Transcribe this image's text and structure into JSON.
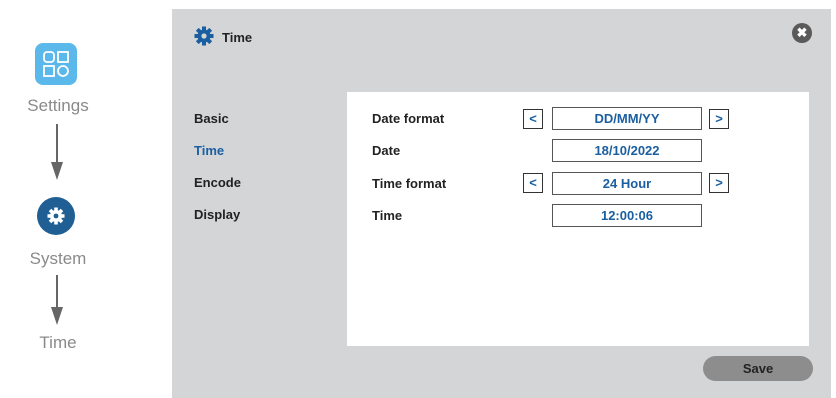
{
  "breadcrumbs": {
    "items": [
      {
        "label": "Settings",
        "icon": "settings-grid-icon"
      },
      {
        "label": "System",
        "icon": "gear-icon"
      },
      {
        "label": "Time"
      }
    ]
  },
  "panel": {
    "title": "Time",
    "title_icon": "gear-icon",
    "close_symbol": "✖",
    "menu": [
      {
        "label": "Basic",
        "active": false
      },
      {
        "label": "Time",
        "active": true
      },
      {
        "label": "Encode",
        "active": false
      },
      {
        "label": "Display",
        "active": false
      }
    ],
    "fields": {
      "date_format": {
        "label": "Date format",
        "value": "DD/MM/YY"
      },
      "date": {
        "label": "Date",
        "value": "18/10/2022"
      },
      "time_format": {
        "label": "Time format",
        "value": "24 Hour"
      },
      "time": {
        "label": "Time",
        "value": "12:00:06"
      }
    },
    "prev_symbol": "<",
    "next_symbol": ">",
    "save_label": "Save"
  },
  "colors": {
    "accent": "#1a5fa0",
    "settings_icon_bg": "#5bb8ea",
    "system_icon_bg": "#1f5f94",
    "panel_bg": "#d4d5d7"
  }
}
